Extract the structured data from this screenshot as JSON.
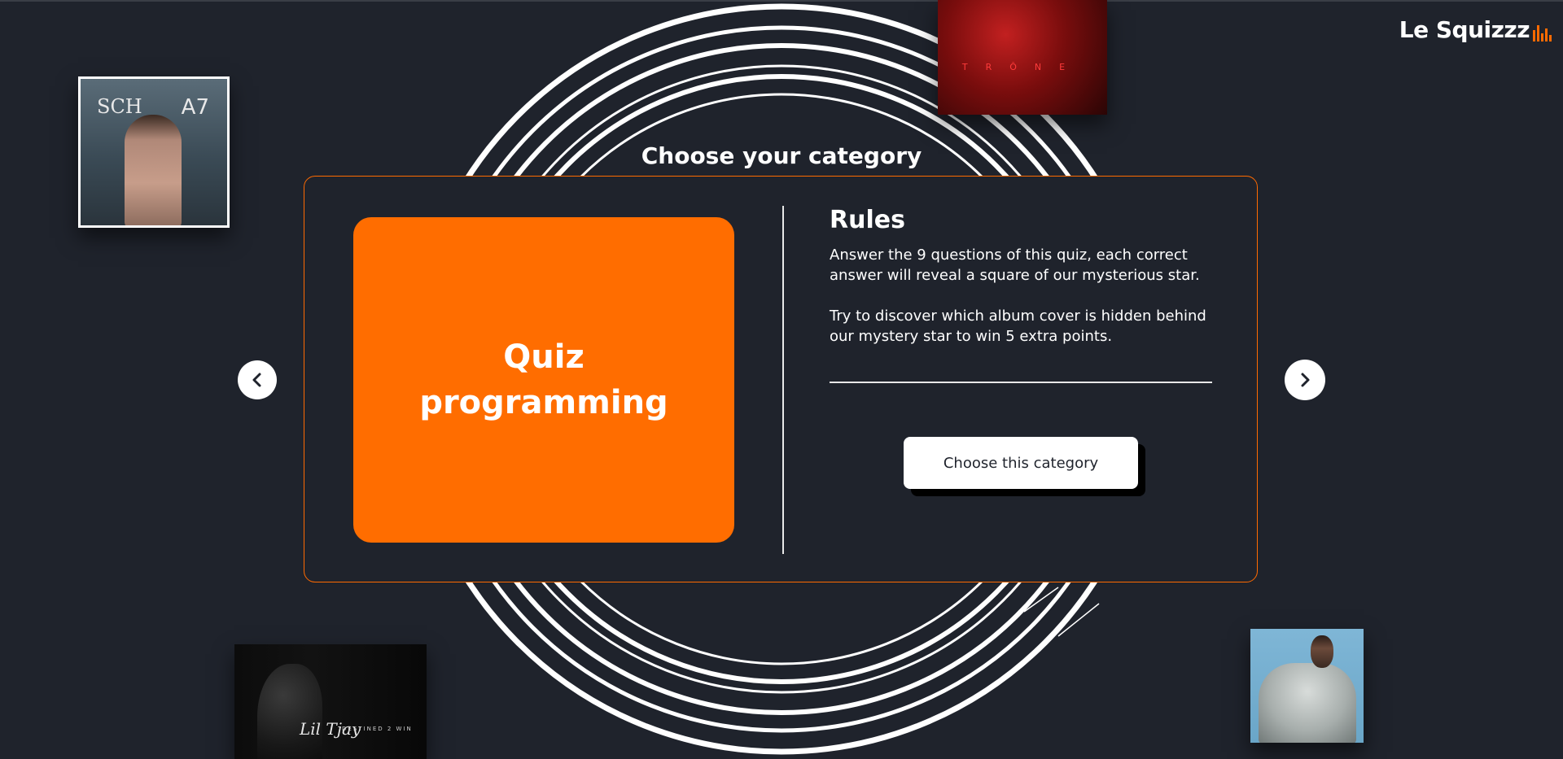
{
  "brand": {
    "name": "Le Squizzz",
    "accent_color": "#ff6a00"
  },
  "heading": "Choose your category",
  "category": {
    "name": "Quiz\nprogramming",
    "color": "#ff6d00"
  },
  "rules": {
    "title": "Rules",
    "text": "Answer the 9 questions of this quiz, each correct answer will reveal a square of our mysterious star.\n\nTry to discover which album cover is hidden behind our mystery star to win 5 extra points.",
    "button_label": "Choose this category"
  },
  "navigation": {
    "prev_icon": "chevron-left-icon",
    "next_icon": "chevron-right-icon"
  },
  "album_covers": {
    "top_left": {
      "text_left": "SCH",
      "text_right": "A7"
    },
    "top_center": {
      "title": "TRÔNE"
    },
    "bottom_left": {
      "signature": "Lil Tjay",
      "subtitle": "DESTINED 2 WIN"
    },
    "bottom_right": {}
  }
}
